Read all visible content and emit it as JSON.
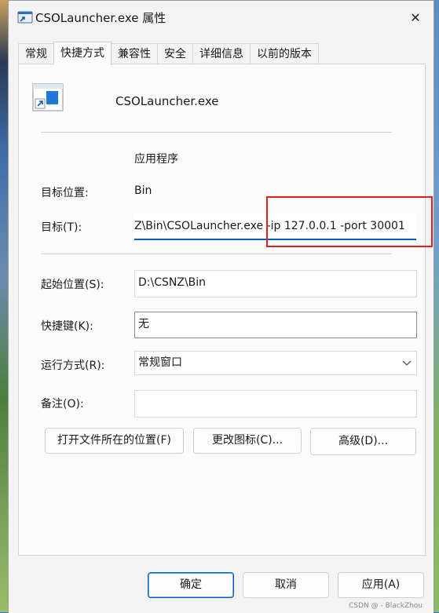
{
  "window": {
    "title": "CSOLauncher.exe 属性",
    "close_glyph": "✕"
  },
  "tabs": [
    {
      "label": "常规",
      "active": false
    },
    {
      "label": "快捷方式",
      "active": true
    },
    {
      "label": "兼容性",
      "active": false
    },
    {
      "label": "安全",
      "active": false
    },
    {
      "label": "详细信息",
      "active": false
    },
    {
      "label": "以前的版本",
      "active": false
    }
  ],
  "shortcut": {
    "file_name": "CSOLauncher.exe",
    "icon": "shortcut-app-icon",
    "target_type_value": "应用程序",
    "target_location_label": "目标位置:",
    "target_location_value": "Bin",
    "target_label": "目标(T):",
    "target_value": "Z\\Bin\\CSOLauncher.exe -ip 127.0.0.1 -port 30001",
    "start_in_label": "起始位置(S):",
    "start_in_value": "D:\\CSNZ\\Bin",
    "hotkey_label": "快捷键(K):",
    "hotkey_value": "无",
    "run_label": "运行方式(R):",
    "run_value": "常规窗口",
    "comment_label": "备注(O):",
    "comment_value": ""
  },
  "actions": {
    "open_location": "打开文件所在的位置(F)",
    "change_icon": "更改图标(C)...",
    "advanced": "高级(D)..."
  },
  "footer": {
    "ok": "确定",
    "cancel": "取消",
    "apply": "应用(A)"
  },
  "watermark": "CSDN @ - BlackZhou",
  "colors": {
    "accent": "#005fb8",
    "highlight": "#e02020"
  }
}
